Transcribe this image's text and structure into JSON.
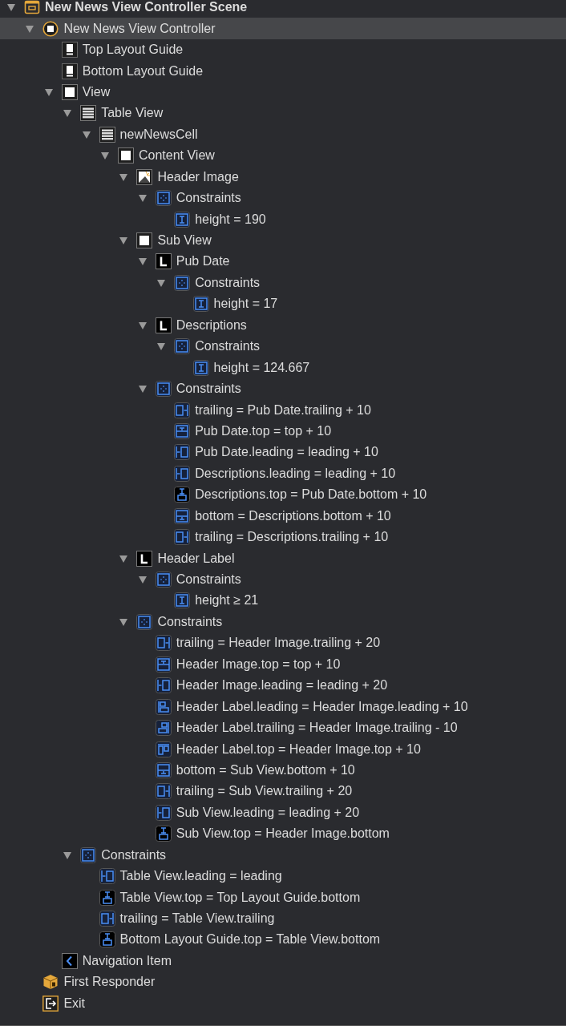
{
  "outline": [
    {
      "label": "New News View Controller Scene",
      "kind": "scene",
      "expanded": true,
      "selected": false,
      "children": [
        {
          "label": "New News View Controller",
          "kind": "controller",
          "expanded": true,
          "selected": true,
          "children": [
            {
              "label": "Top Layout Guide",
              "kind": "guide",
              "selected": false
            },
            {
              "label": "Bottom Layout Guide",
              "kind": "guide",
              "selected": false
            },
            {
              "label": "View",
              "kind": "view",
              "expanded": true,
              "selected": false,
              "children": [
                {
                  "label": "Table View",
                  "kind": "table",
                  "expanded": true,
                  "selected": false,
                  "children": [
                    {
                      "label": "newNewsCell",
                      "kind": "cell",
                      "expanded": true,
                      "selected": false,
                      "children": [
                        {
                          "label": "Content View",
                          "kind": "view",
                          "expanded": true,
                          "selected": false,
                          "children": [
                            {
                              "label": "Header Image",
                              "kind": "image",
                              "expanded": true,
                              "selected": false,
                              "children": [
                                {
                                  "label": "Constraints",
                                  "kind": "constraints",
                                  "expanded": true,
                                  "selected": false,
                                  "children": [
                                    {
                                      "label": "height = 190",
                                      "kind": "height",
                                      "selected": false
                                    }
                                  ]
                                }
                              ]
                            },
                            {
                              "label": "Sub View",
                              "kind": "view",
                              "expanded": true,
                              "selected": false,
                              "children": [
                                {
                                  "label": "Pub Date",
                                  "kind": "label",
                                  "expanded": true,
                                  "selected": false,
                                  "children": [
                                    {
                                      "label": "Constraints",
                                      "kind": "constraints",
                                      "expanded": true,
                                      "selected": false,
                                      "children": [
                                        {
                                          "label": "height = 17",
                                          "kind": "height",
                                          "selected": false
                                        }
                                      ]
                                    }
                                  ]
                                },
                                {
                                  "label": "Descriptions",
                                  "kind": "label",
                                  "expanded": true,
                                  "selected": false,
                                  "children": [
                                    {
                                      "label": "Constraints",
                                      "kind": "constraints",
                                      "expanded": true,
                                      "selected": false,
                                      "children": [
                                        {
                                          "label": "height = 124.667",
                                          "kind": "height",
                                          "selected": false
                                        }
                                      ]
                                    }
                                  ]
                                },
                                {
                                  "label": "Constraints",
                                  "kind": "constraints",
                                  "expanded": true,
                                  "selected": false,
                                  "children": [
                                    {
                                      "label": "trailing = Pub Date.trailing + 10",
                                      "kind": "trailing",
                                      "selected": false
                                    },
                                    {
                                      "label": "Pub Date.top = top + 10",
                                      "kind": "top",
                                      "selected": false
                                    },
                                    {
                                      "label": "Pub Date.leading = leading + 10",
                                      "kind": "leading",
                                      "selected": false
                                    },
                                    {
                                      "label": "Descriptions.leading = leading + 10",
                                      "kind": "leading",
                                      "selected": false
                                    },
                                    {
                                      "label": "Descriptions.top = Pub Date.bottom + 10",
                                      "kind": "vspacing",
                                      "selected": false
                                    },
                                    {
                                      "label": "bottom = Descriptions.bottom + 10",
                                      "kind": "bottom",
                                      "selected": false
                                    },
                                    {
                                      "label": "trailing = Descriptions.trailing + 10",
                                      "kind": "trailing",
                                      "selected": false
                                    }
                                  ]
                                }
                              ]
                            },
                            {
                              "label": "Header Label",
                              "kind": "label",
                              "expanded": true,
                              "selected": false,
                              "children": [
                                {
                                  "label": "Constraints",
                                  "kind": "constraints",
                                  "expanded": true,
                                  "selected": false,
                                  "children": [
                                    {
                                      "label": "height ≥ 21",
                                      "kind": "height",
                                      "selected": false
                                    }
                                  ]
                                }
                              ]
                            },
                            {
                              "label": "Constraints",
                              "kind": "constraints",
                              "expanded": true,
                              "selected": false,
                              "children": [
                                {
                                  "label": "trailing = Header Image.trailing + 20",
                                  "kind": "trailing",
                                  "selected": false
                                },
                                {
                                  "label": "Header Image.top = top + 10",
                                  "kind": "top",
                                  "selected": false
                                },
                                {
                                  "label": "Header Image.leading = leading + 20",
                                  "kind": "leading",
                                  "selected": false
                                },
                                {
                                  "label": "Header Label.leading = Header Image.leading + 10",
                                  "kind": "align-leading",
                                  "selected": false
                                },
                                {
                                  "label": "Header Label.trailing = Header Image.trailing - 10",
                                  "kind": "align-trailing",
                                  "selected": false
                                },
                                {
                                  "label": "Header Label.top = Header Image.top + 10",
                                  "kind": "align-top",
                                  "selected": false
                                },
                                {
                                  "label": "bottom = Sub View.bottom + 10",
                                  "kind": "bottom",
                                  "selected": false
                                },
                                {
                                  "label": "trailing = Sub View.trailing + 20",
                                  "kind": "trailing",
                                  "selected": false
                                },
                                {
                                  "label": "Sub View.leading = leading + 20",
                                  "kind": "leading",
                                  "selected": false
                                },
                                {
                                  "label": "Sub View.top = Header Image.bottom",
                                  "kind": "vspacing",
                                  "selected": false
                                }
                              ]
                            }
                          ]
                        }
                      ]
                    }
                  ]
                },
                {
                  "label": "Constraints",
                  "kind": "constraints",
                  "expanded": true,
                  "selected": false,
                  "children": [
                    {
                      "label": "Table View.leading = leading",
                      "kind": "leading",
                      "selected": false
                    },
                    {
                      "label": "Table View.top = Top Layout Guide.bottom",
                      "kind": "vspacing",
                      "selected": false
                    },
                    {
                      "label": "trailing = Table View.trailing",
                      "kind": "trailing",
                      "selected": false
                    },
                    {
                      "label": "Bottom Layout Guide.top = Table View.bottom",
                      "kind": "vspacing",
                      "selected": false
                    }
                  ]
                }
              ]
            },
            {
              "label": "Navigation Item",
              "kind": "nav",
              "selected": false
            }
          ]
        },
        {
          "label": "First Responder",
          "kind": "responder",
          "selected": false
        },
        {
          "label": "Exit",
          "kind": "exit",
          "selected": false
        }
      ]
    }
  ]
}
